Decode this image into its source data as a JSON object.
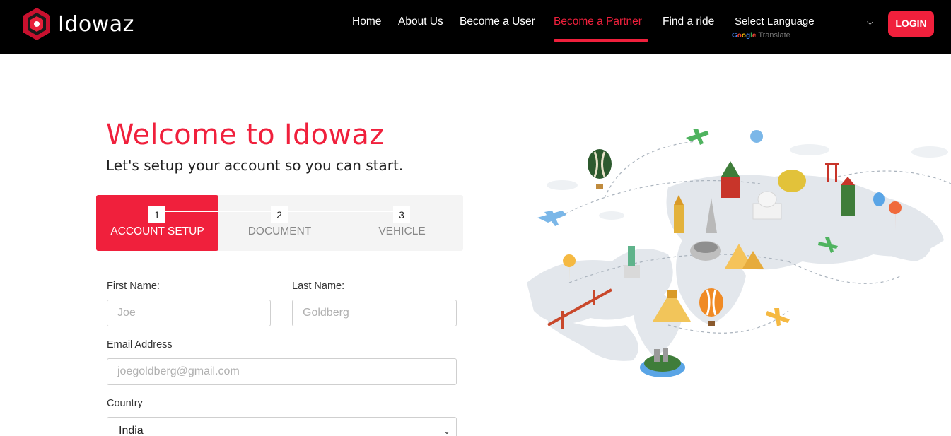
{
  "brand": {
    "name": "Idowaz",
    "accent": "#f0203c"
  },
  "nav": {
    "items": [
      {
        "label": "Home",
        "active": false
      },
      {
        "label": "About Us",
        "active": false
      },
      {
        "label": "Become a User",
        "active": false
      },
      {
        "label": "Become a Partner",
        "active": true
      },
      {
        "label": "Find a ride",
        "active": false
      }
    ],
    "language": {
      "label": "Select Language",
      "powered_by_brand": "Google",
      "powered_by_text": "Translate"
    },
    "login_label": "LOGIN"
  },
  "hero": {
    "title": "Welcome to Idowaz",
    "subtitle": "Let's setup your account so you can start."
  },
  "steps": [
    {
      "number": "1",
      "label": "ACCOUNT SETUP",
      "active": true
    },
    {
      "number": "2",
      "label": "DOCUMENT",
      "active": false
    },
    {
      "number": "3",
      "label": "VEHICLE",
      "active": false
    }
  ],
  "form": {
    "first_name": {
      "label": "First Name:",
      "placeholder": "Joe",
      "value": ""
    },
    "last_name": {
      "label": "Last Name:",
      "placeholder": "Goldberg",
      "value": ""
    },
    "email": {
      "label": "Email Address",
      "placeholder": "joegoldberg@gmail.com",
      "value": ""
    },
    "country": {
      "label": "Country",
      "selected": "India"
    }
  },
  "illustration": {
    "icon": "world-travel-map-illustration"
  }
}
